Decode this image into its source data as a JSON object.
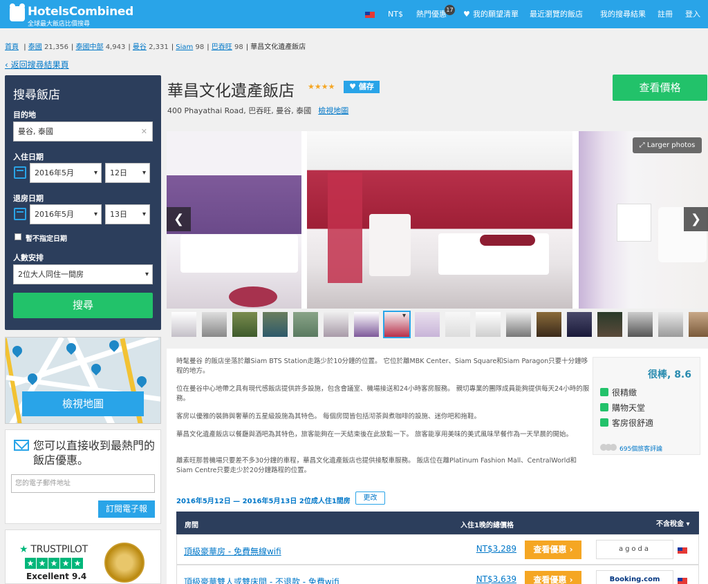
{
  "header": {
    "brand": "HotelsCombined",
    "tagline": "全球最大飯店比價搜尋",
    "currency": "NT$",
    "nav": [
      "熱門優惠",
      "我的願望清單",
      "最近瀏覽的飯店",
      "我的搜尋結果",
      "註冊",
      "登入"
    ],
    "deals_count": "17"
  },
  "breadcrumb": {
    "items": [
      {
        "label": "首頁",
        "count": ""
      },
      {
        "label": "泰國",
        "count": "21,356"
      },
      {
        "label": "泰國中部",
        "count": "4,943"
      },
      {
        "label": "曼谷",
        "count": "2,331"
      },
      {
        "label": "Siam",
        "count": "98"
      },
      {
        "label": "巴吞旺",
        "count": "98"
      }
    ],
    "current": "華昌文化遺產飯店",
    "back_link": "返回搜尋結果頁"
  },
  "search": {
    "title": "搜尋飯店",
    "destination_label": "目的地",
    "destination_value": "曼谷, 泰國",
    "checkin_label": "入住日期",
    "checkin_month": "2016年5月",
    "checkin_day": "12日",
    "checkout_label": "退房日期",
    "checkout_month": "2016年5月",
    "checkout_day": "13日",
    "no_date_label": "暫不指定日期",
    "guests_label": "人數安排",
    "guests_value": "2位大人同住一間房",
    "search_button": "搜尋"
  },
  "map": {
    "button": "檢視地圖"
  },
  "newsletter": {
    "text": "您可以直接收到最熱門的飯店優惠。",
    "email_placeholder": "您的電子郵件地址",
    "subscribe": "訂閱電子報"
  },
  "trustpilot": {
    "brand": "TRUSTPILOT",
    "score": "Excellent 9.4"
  },
  "hotel": {
    "name": "華昌文化遺產飯店",
    "stars": "★★★★",
    "save": "儲存",
    "address": "400 Phayathai Road, 巴吞旺, 曼谷, 泰國",
    "map_link": "檢視地圖",
    "view_prices": "查看價格",
    "larger_photos": "Larger photos"
  },
  "description": [
    "時髦曼谷 的飯店坐落於離Siam BTS Station走路少於10分鐘的位置。 它位於離MBK Center、Siam Square和Siam Paragon只要十分鐘哆程的地方。",
    "位在曼谷中心地帶之具有現代感飯店提供許多設施，包含會議室、機場接送和24小時客房服務。 親切專業的團隊成員能夠提供每天24小時的服務。",
    "客房以優雅的裝飾與奢華的五星級設施為其特色。 每個房間皆包括沏茶與煮咖啡的設施、迷你吧和拖鞋。",
    "華昌文化遺產飯店以餐廳與酒吧為其特色，旅客能夠在一天結束後在此放鬆一下。 旅客能享用美味的美式風味早餐作為一天早晨的開始。",
    "離素旺那普機場只要差不多30分鐘的車程，華昌文化遺產飯店也提供接駁車服務。 飯店位在離Platinum Fashion Mall、CentralWorld和Siam Centre只要走少於20分鐘路程的位置。"
  ],
  "rating": {
    "score": "很棒, 8.6",
    "highlights": [
      "很精緻",
      "購物天堂",
      "客房很舒適"
    ],
    "reviews": "695個旅客評論"
  },
  "booking": {
    "dates": "2016年5月12日 — 2016年5月13日  2位成人住1間房",
    "change": "更改",
    "col_room": "房間",
    "col_price": "入住1晚的總價格",
    "col_tax": "不含稅金 ▾",
    "rows": [
      {
        "room": "頂級豪華房 - 免費無線wifi",
        "price": "NT$3,289",
        "deal": "查看優惠",
        "partner": "agoda"
      },
      {
        "room": "頂級豪華雙人或雙床間 - 不退款 - 免費wifi",
        "price": "NT$3,639",
        "deal": "查看優惠",
        "partner": "Booking.com"
      }
    ]
  },
  "colors": {
    "brand_blue": "#29a4e8",
    "navy": "#2c3e5c",
    "green": "#22c26a",
    "orange": "#f5a623"
  }
}
